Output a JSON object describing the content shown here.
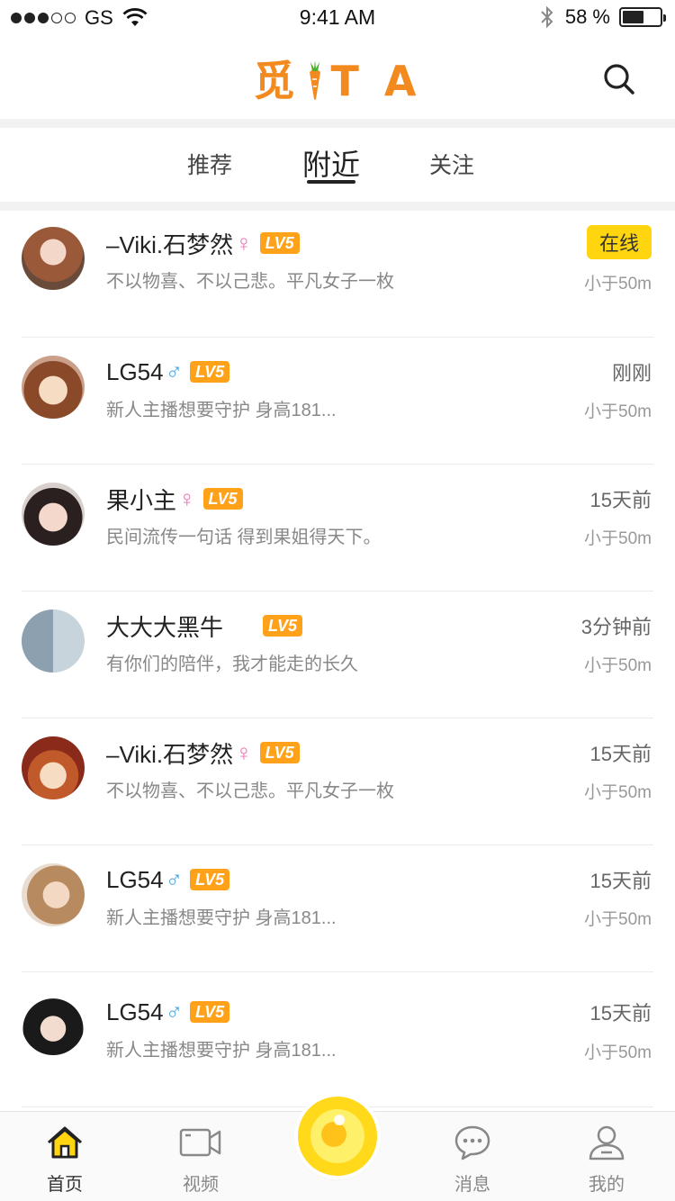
{
  "status_bar": {
    "carrier": "GS",
    "time": "9:41 AM",
    "battery_percent": "58 %",
    "battery_level": 0.58
  },
  "header": {
    "logo_text_1": "觅",
    "logo_text_2": "T",
    "logo_text_3": "A",
    "search_icon": "search-icon",
    "accent_color": "#f28a1f"
  },
  "tabs": {
    "items": [
      {
        "label": "推荐"
      },
      {
        "label": "附近"
      },
      {
        "label": "关注"
      }
    ],
    "active_index": 1
  },
  "list": [
    {
      "name": "–Viki.石梦然",
      "gender": "♀",
      "level": "LV5",
      "signature": "不以物喜、不以己悲。平凡女子一枚",
      "status": "在线",
      "distance": "小于50m"
    },
    {
      "name": "LG54",
      "gender": "♂",
      "level": "LV5",
      "signature": "新人主播想要守护   身高181...",
      "status": "刚刚",
      "distance": "小于50m"
    },
    {
      "name": "果小主",
      "gender": "♀",
      "level": "LV5",
      "signature": "民间流传一句话 得到果姐得天下。",
      "status": "15天前",
      "distance": "小于50m"
    },
    {
      "name": "大大大黑牛",
      "gender": "",
      "level": "LV5",
      "signature": "有你们的陪伴，我才能走的长久",
      "status": "3分钟前",
      "distance": "小于50m"
    },
    {
      "name": "–Viki.石梦然",
      "gender": "♀",
      "level": "LV5",
      "signature": "不以物喜、不以己悲。平凡女子一枚",
      "status": "15天前",
      "distance": "小于50m"
    },
    {
      "name": "LG54",
      "gender": "♂",
      "level": "LV5",
      "signature": "新人主播想要守护   身高181...",
      "status": "15天前",
      "distance": "小于50m"
    },
    {
      "name": "LG54",
      "gender": "♂",
      "level": "LV5",
      "signature": "新人主播想要守护   身高181...",
      "status": "15天前",
      "distance": "小于50m"
    }
  ],
  "tabbar": {
    "items": [
      {
        "label": "首页",
        "icon": "home-icon"
      },
      {
        "label": "视频",
        "icon": "video-icon"
      },
      {
        "label": "消息",
        "icon": "message-icon"
      },
      {
        "label": "我的",
        "icon": "user-icon"
      }
    ],
    "center_icon": "live-icon",
    "active_index": 0
  },
  "colors": {
    "online_badge": "#ffd510",
    "level_badge": "#ffa21a",
    "female": "#ef72b4",
    "male": "#4aa6e0"
  }
}
